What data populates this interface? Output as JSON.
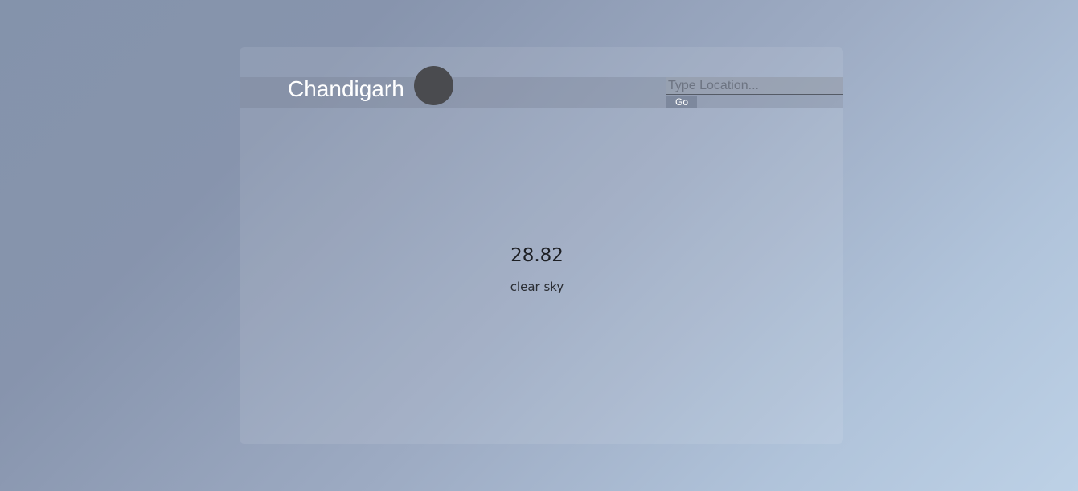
{
  "location": {
    "city": "Chandigarh"
  },
  "weather_icon": {
    "icon": "weather-condition-icon",
    "color": "#4a4b4f"
  },
  "search": {
    "placeholder": "Type Location...",
    "value": "",
    "go_label": "Go"
  },
  "current": {
    "temperature": "28.82",
    "description": "clear sky"
  },
  "colors": {
    "background_start": "#8493ab",
    "background_end": "#bdd1e6",
    "button": "#7d889d"
  }
}
